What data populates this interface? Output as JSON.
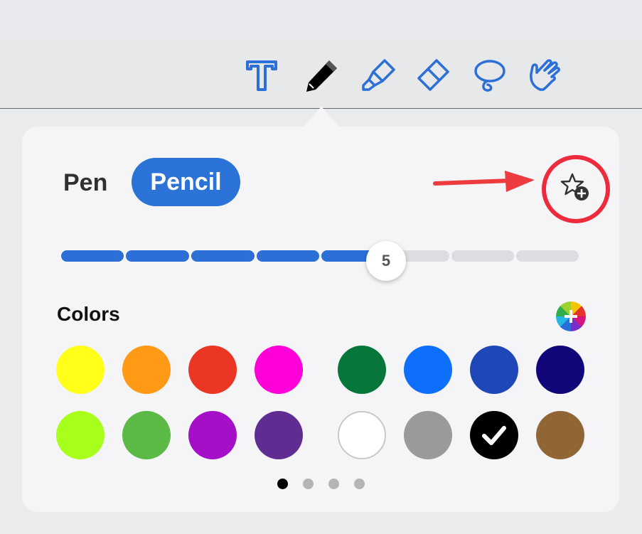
{
  "toolbar": {
    "tools": [
      {
        "name": "text-tool-icon",
        "selected": false
      },
      {
        "name": "pencil-tool-icon",
        "selected": true
      },
      {
        "name": "highlighter-tool-icon",
        "selected": false
      },
      {
        "name": "eraser-tool-icon",
        "selected": false
      },
      {
        "name": "lasso-tool-icon",
        "selected": false
      },
      {
        "name": "hand-tool-icon",
        "selected": false
      }
    ],
    "accent_color": "#2c6fd6"
  },
  "panel": {
    "tabs": {
      "pen": "Pen",
      "pencil": "Pencil",
      "selected": "Pencil"
    },
    "favorite_button_icon": "star-plus-icon",
    "annotation": {
      "arrow_color": "#ee3b3f",
      "highlight_ring_color": "#ee2b3c"
    },
    "thickness": {
      "value": "5",
      "steps": 8,
      "filled_steps": 5
    },
    "colors": {
      "label": "Colors",
      "add_icon": "color-wheel-plus-icon",
      "swatches": [
        "#ffff1a",
        "#ff9a16",
        "#ec3624",
        "#ff00d8",
        "#07763a",
        "#0d6ffc",
        "#1f47b7",
        "#11057a",
        "#a9ff1c",
        "#5bb946",
        "#a410c8",
        "#5f2d91",
        "#ffffff",
        "#9a9a9a",
        "#000000",
        "#906634"
      ],
      "selected_index": 14
    },
    "pages": {
      "count": 4,
      "current": 0
    }
  }
}
